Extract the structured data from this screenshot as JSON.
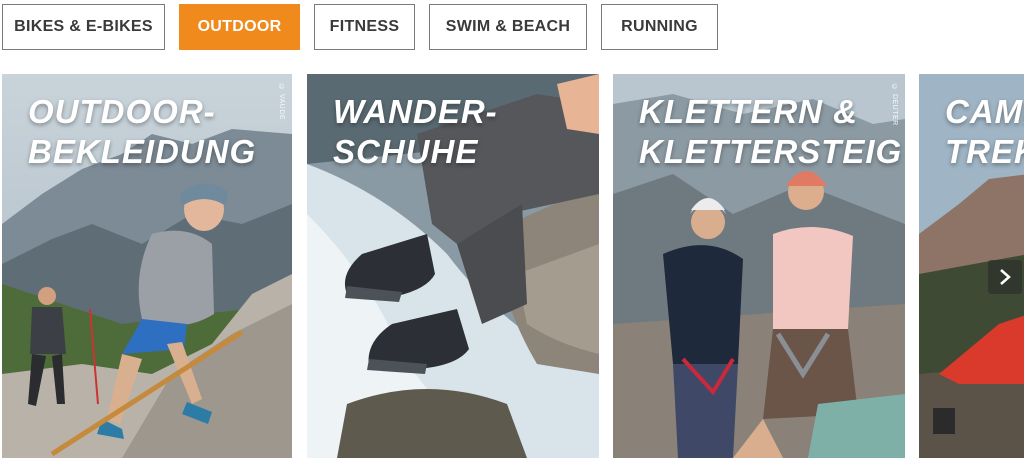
{
  "tabs": [
    {
      "label": "BIKES & E-BIKES",
      "active": false
    },
    {
      "label": "OUTDOOR",
      "active": true
    },
    {
      "label": "FITNESS",
      "active": false
    },
    {
      "label": "SWIM & BEACH",
      "active": false
    },
    {
      "label": "RUNNING",
      "active": false
    }
  ],
  "colors": {
    "accent": "#f08a1c",
    "tab_border": "#7a7a7a",
    "tab_text": "#3a3a3a"
  },
  "cards": [
    {
      "title_lines": [
        "OUTDOOR-",
        "BEKLEIDUNG"
      ],
      "credit": "© VAUDE"
    },
    {
      "title_lines": [
        "WANDER-",
        "SCHUHE"
      ],
      "credit": ""
    },
    {
      "title_lines": [
        "KLETTERN &",
        "KLETTERSTEIG"
      ],
      "credit": "© DEUTER"
    },
    {
      "title_lines": [
        "CAMP",
        "TREK"
      ],
      "credit": ""
    }
  ],
  "carousel": {
    "next_icon": "chevron-right-icon"
  }
}
